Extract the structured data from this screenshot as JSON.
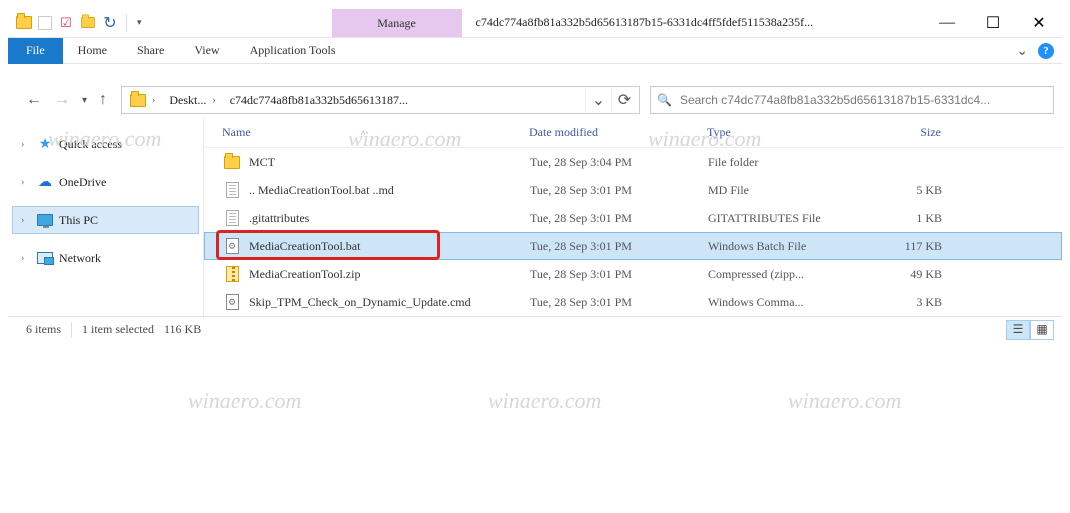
{
  "window": {
    "title": "c74dc774a8fb81a332b5d65613187b15-6331dc4ff5fdef511538a235f...",
    "context_tab": "Manage"
  },
  "titlebar": {
    "qat_dropdown_glyph": "▾",
    "min_glyph": "—",
    "max_glyph": "☐",
    "close_glyph": "✕"
  },
  "ribbon": {
    "file": "File",
    "tabs": [
      "Home",
      "Share",
      "View"
    ],
    "context_tab": "Application Tools",
    "expand_glyph": "⌄",
    "help_glyph": "?"
  },
  "nav": {
    "back_glyph": "←",
    "forward_glyph": "→",
    "recent_glyph": "▾",
    "up_glyph": "↑",
    "chevron_glyph": "›",
    "dropdown_glyph": "⌄",
    "refresh_glyph": "⟳",
    "search_glyph": "🔍"
  },
  "address": {
    "root_chevron": "›",
    "seg1": "Deskt...",
    "seg2": "c74dc774a8fb81a332b5d65613187..."
  },
  "search": {
    "placeholder": "Search c74dc774a8fb81a332b5d65613187b15-6331dc4..."
  },
  "sidebar": {
    "items": [
      {
        "label": "Quick access",
        "icon": "star",
        "expandable": true
      },
      {
        "label": "OneDrive",
        "icon": "cloud",
        "expandable": true
      },
      {
        "label": "This PC",
        "icon": "monitor",
        "expandable": true,
        "selected": true
      },
      {
        "label": "Network",
        "icon": "net",
        "expandable": true
      }
    ]
  },
  "columns": {
    "name": "Name",
    "date": "Date modified",
    "type": "Type",
    "size": "Size",
    "sort_glyph": "˄"
  },
  "files": [
    {
      "name": "MCT",
      "date": "Tue, 28 Sep 3:04 PM",
      "type": "File folder",
      "size": "",
      "icon": "folder"
    },
    {
      "name": ".. MediaCreationTool.bat ..md",
      "date": "Tue, 28 Sep 3:01 PM",
      "type": "MD File",
      "size": "5 KB",
      "icon": "md"
    },
    {
      "name": ".gitattributes",
      "date": "Tue, 28 Sep 3:01 PM",
      "type": "GITATTRIBUTES File",
      "size": "1 KB",
      "icon": "gita"
    },
    {
      "name": "MediaCreationTool.bat",
      "date": "Tue, 28 Sep 3:01 PM",
      "type": "Windows Batch File",
      "size": "117 KB",
      "icon": "bat",
      "selected": true,
      "highlight": true
    },
    {
      "name": "MediaCreationTool.zip",
      "date": "Tue, 28 Sep 3:01 PM",
      "type": "Compressed (zipp...",
      "size": "49 KB",
      "icon": "zip"
    },
    {
      "name": "Skip_TPM_Check_on_Dynamic_Update.cmd",
      "date": "Tue, 28 Sep 3:01 PM",
      "type": "Windows Comma...",
      "size": "3 KB",
      "icon": "cmd"
    }
  ],
  "status": {
    "items": "6 items",
    "selected": "1 item selected",
    "size": "116 KB"
  },
  "watermark": "winaero.com"
}
